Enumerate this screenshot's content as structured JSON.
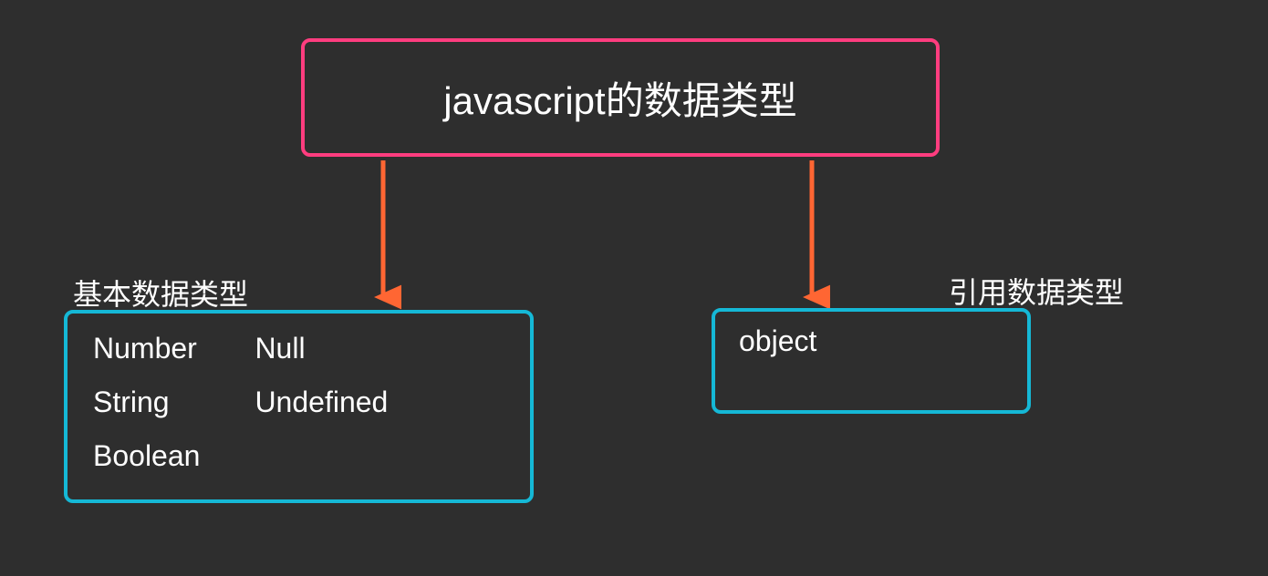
{
  "diagram": {
    "root": {
      "title": "javascript的数据类型"
    },
    "left": {
      "label": "基本数据类型",
      "col1": [
        "Number",
        "String",
        "Boolean"
      ],
      "col2": [
        "Null",
        "Undefined"
      ]
    },
    "right": {
      "label": "引用数据类型",
      "items": [
        "object"
      ]
    },
    "colors": {
      "background": "#2e2e2e",
      "rootBorder": "#ff3d7f",
      "childBorder": "#15b8d6",
      "arrow": "#ff6633",
      "text": "#ffffff"
    }
  }
}
